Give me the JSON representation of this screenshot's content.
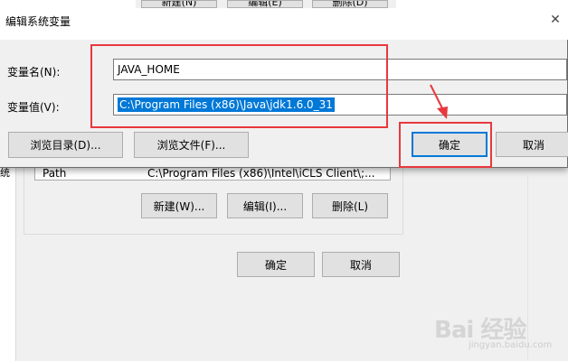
{
  "background_dialog": {
    "top_buttons": [
      "新建(N)",
      "编辑(E)",
      "删除(D)"
    ],
    "list_row": {
      "variable": "Path",
      "value": "C:\\Program Files (x86)\\Intel\\iCLS Client\\;..."
    },
    "cut_char": "统",
    "buttons": {
      "new": "新建(W)...",
      "edit": "编辑(I)...",
      "delete": "删除(L)"
    },
    "ok_label": "确定",
    "cancel_label": "取消"
  },
  "dialog": {
    "title": "编辑系统变量",
    "close_glyph": "✕",
    "name_label": "变量名(N):",
    "name_value": "JAVA_HOME",
    "value_label": "变量值(V):",
    "value_value": "C:\\Program Files (x86)\\Java\\jdk1.6.0_31",
    "browse_dir_label": "浏览目录(D)...",
    "browse_file_label": "浏览文件(F)...",
    "ok_label": "确定",
    "cancel_label": "取消"
  },
  "colors": {
    "annotation": "#e8383d",
    "selection": "#0078d7",
    "button_face": "#e1e1e1"
  },
  "watermark": {
    "brand": "Bai 经验",
    "url": "jingyan.baidu.com"
  }
}
